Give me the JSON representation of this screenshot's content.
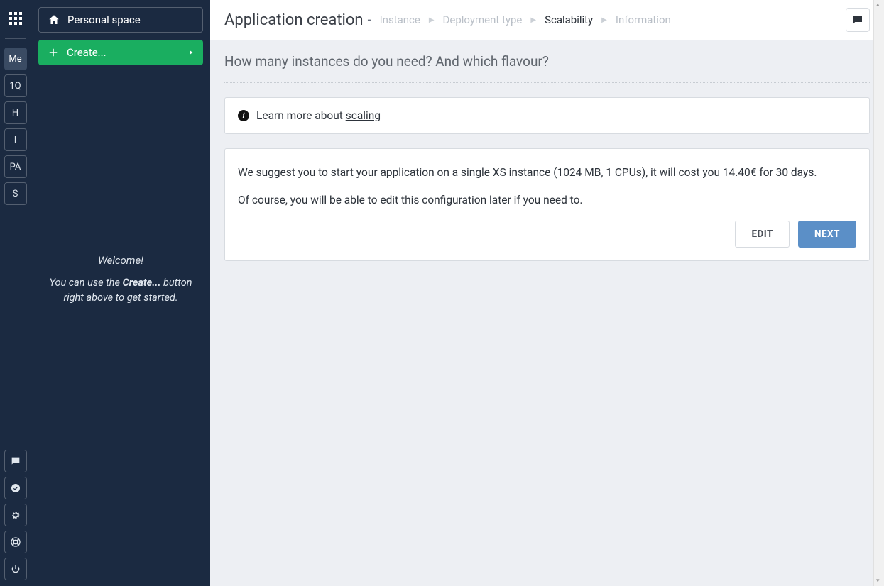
{
  "rail": {
    "top_items": [
      {
        "label": "Me",
        "active": true
      },
      {
        "label": "1Q",
        "active": false
      },
      {
        "label": "H",
        "active": false
      },
      {
        "label": "I",
        "active": false
      },
      {
        "label": "PA",
        "active": false
      },
      {
        "label": "S",
        "active": false
      }
    ]
  },
  "sidebar": {
    "personal_label": "Personal space",
    "create_label": "Create...",
    "welcome_title": "Welcome!",
    "welcome_before": "You can use the ",
    "welcome_bold": "Create...",
    "welcome_after": " button right above to get started."
  },
  "header": {
    "title": "Application creation",
    "crumbs": [
      {
        "label": "Instance",
        "active": false
      },
      {
        "label": "Deployment type",
        "active": false
      },
      {
        "label": "Scalability",
        "active": true
      },
      {
        "label": "Information",
        "active": false
      }
    ]
  },
  "content": {
    "subtitle": "How many instances do you need? And which flavour?",
    "info_prefix": "Learn more about ",
    "info_link": "scaling",
    "suggest_line1": "We suggest you to start your application on a single XS instance (1024 MB, 1 CPUs), it will cost you 14.40€ for 30 days.",
    "suggest_line2": "Of course, you will be able to edit this configuration later if you need to.",
    "edit_label": "EDIT",
    "next_label": "NEXT"
  }
}
